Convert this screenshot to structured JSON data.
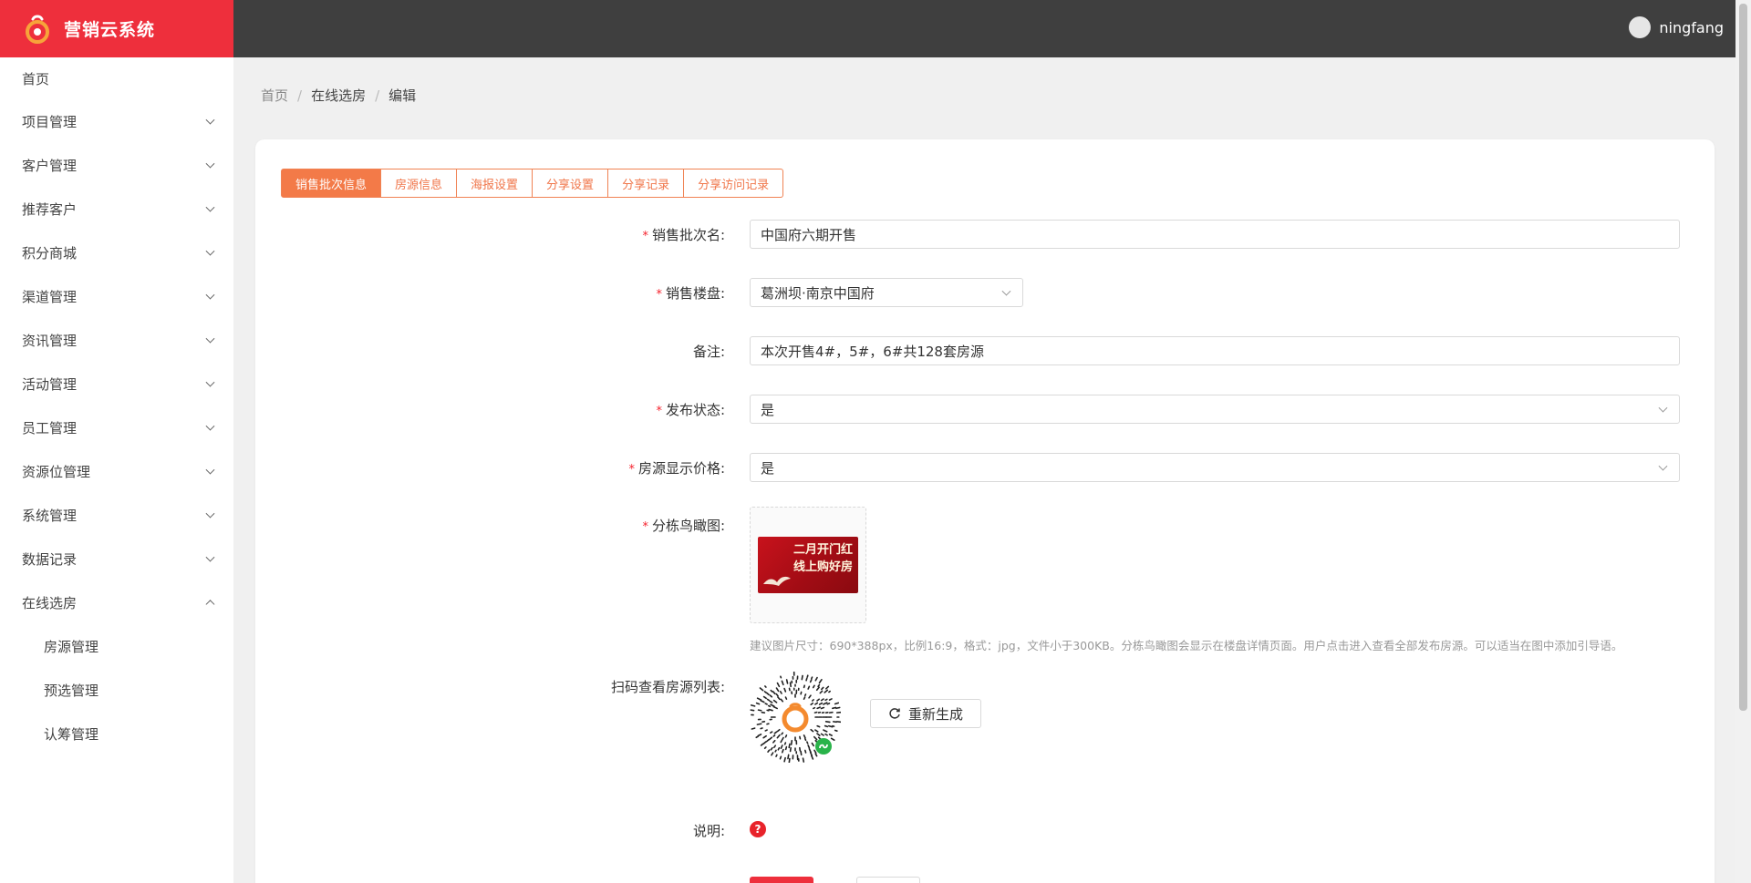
{
  "app": {
    "title": "营销云系统",
    "username": "ningfang",
    "brand_color": "#ee2f3c",
    "header_color": "#3f3f3f",
    "accent_color": "#f37a48"
  },
  "sidebar": {
    "home": "首页",
    "items": [
      {
        "label": "项目管理",
        "icon": "chevron-down-icon"
      },
      {
        "label": "客户管理",
        "icon": "chevron-down-icon"
      },
      {
        "label": "推荐客户",
        "icon": "chevron-down-icon"
      },
      {
        "label": "积分商城",
        "icon": "chevron-down-icon"
      },
      {
        "label": "渠道管理",
        "icon": "chevron-down-icon"
      },
      {
        "label": "资讯管理",
        "icon": "chevron-down-icon"
      },
      {
        "label": "活动管理",
        "icon": "chevron-down-icon"
      },
      {
        "label": "员工管理",
        "icon": "chevron-down-icon"
      },
      {
        "label": "资源位管理",
        "icon": "chevron-down-icon"
      },
      {
        "label": "系统管理",
        "icon": "chevron-down-icon"
      },
      {
        "label": "数据记录",
        "icon": "chevron-down-icon"
      },
      {
        "label": "在线选房",
        "icon": "chevron-up-icon"
      }
    ],
    "sub_items": [
      "房源管理",
      "预选管理",
      "认筹管理"
    ]
  },
  "breadcrumb": [
    "首页",
    "在线选房",
    "编辑"
  ],
  "tabs": [
    "销售批次信息",
    "房源信息",
    "海报设置",
    "分享设置",
    "分享记录",
    "分享访问记录"
  ],
  "form": {
    "batch_name": {
      "label": "销售批次名:",
      "value": "中国府六期开售"
    },
    "property": {
      "label": "销售楼盘:",
      "value": "葛洲坝·南京中国府"
    },
    "remark": {
      "label": "备注:",
      "value": "本次开售4#，5#，6#共128套房源"
    },
    "publish": {
      "label": "发布状态:",
      "value": "是"
    },
    "show_price": {
      "label": "房源显示价格:",
      "value": "是"
    },
    "aerial": {
      "label": "分栋鸟瞰图:",
      "poster_line1": "二月开门红",
      "poster_line2": "线上购好房",
      "hint": "建议图片尺寸：690*388px，比例16:9，格式：jpg，文件小于300KB。分栋鸟瞰图会显示在楼盘详情页面。用户点击进入查看全部发布房源。可以适当在图中添加引导语。"
    },
    "qr": {
      "label": "扫码查看房源列表:",
      "regen_label": "重新生成"
    },
    "note": {
      "label": "说明:",
      "icon": "question-icon",
      "icon_glyph": "?"
    }
  }
}
